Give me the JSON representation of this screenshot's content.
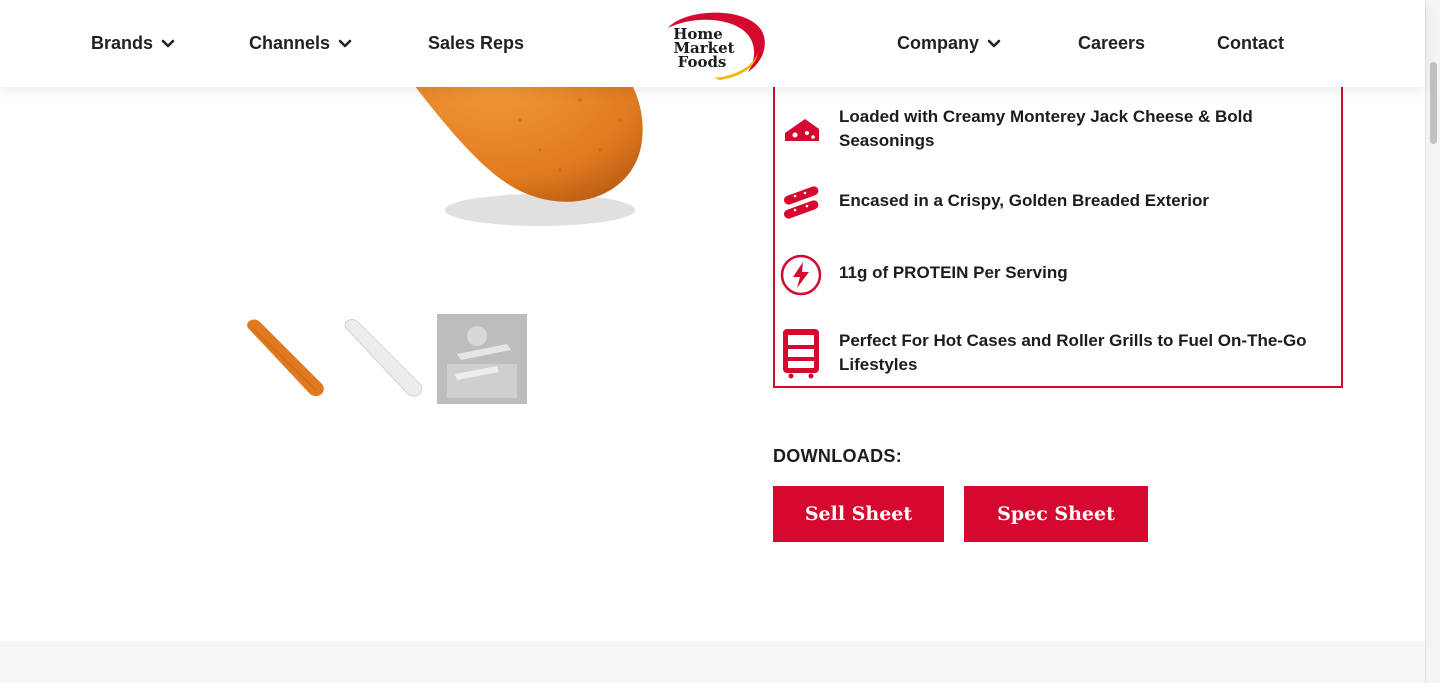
{
  "nav": {
    "left": [
      {
        "label": "Brands",
        "has_dropdown": true
      },
      {
        "label": "Channels",
        "has_dropdown": true
      },
      {
        "label": "Sales Reps",
        "has_dropdown": false
      }
    ],
    "right": [
      {
        "label": "Company",
        "has_dropdown": true
      },
      {
        "label": "Careers",
        "has_dropdown": false
      },
      {
        "label": "Contact",
        "has_dropdown": false
      }
    ],
    "logo": {
      "line1": "Home",
      "line2": "Market",
      "line3": "Foods"
    }
  },
  "features": [
    {
      "icon": "cheese-icon",
      "text": "Loaded with Creamy Monterey Jack Cheese & Bold Seasonings"
    },
    {
      "icon": "breaded-sticks-icon",
      "text": "Encased in a Crispy, Golden Breaded Exterior"
    },
    {
      "icon": "lightning-bolt-icon",
      "text": "11g of PROTEIN Per Serving"
    },
    {
      "icon": "hot-case-icon",
      "text": "Perfect For Hot Cases and Roller Grills to Fuel On-The-Go Lifestyles"
    }
  ],
  "downloads": {
    "title": "DOWNLOADS:",
    "sell_sheet": "Sell Sheet",
    "spec_sheet": "Spec Sheet"
  },
  "colors": {
    "accent": "#d6082f",
    "text": "#1c1c1c",
    "product_orange": "#e07a1f"
  }
}
